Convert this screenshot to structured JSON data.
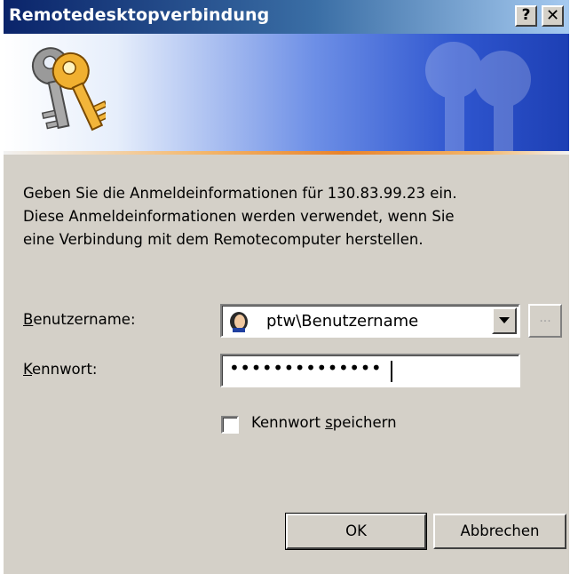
{
  "window": {
    "title": "Remotedesktopverbindung",
    "help_label": "?",
    "close_label": "✕"
  },
  "banner": {
    "icon": "keys-icon",
    "colors": {
      "gradient_start": "#ffffff",
      "gradient_end": "#1d3fb4",
      "accent_line": "#e8832b"
    }
  },
  "message": {
    "line1": "Geben Sie die Anmeldeinformationen für 130.83.99.23 ein.",
    "line2": "Diese Anmeldeinformationen werden verwendet, wenn Sie",
    "line3": "eine Verbindung mit dem Remotecomputer herstellen."
  },
  "form": {
    "username_label_accel": "B",
    "username_label_rest": "enutzername:",
    "username_value": "ptw\\Benutzername",
    "username_icon": "user-icon",
    "browse_label": "...",
    "password_label_accel": "K",
    "password_label_rest": "ennwort:",
    "password_value": "••••••••••••••",
    "save_password_pre": "Kennwort ",
    "save_password_accel": "s",
    "save_password_post": "peichern",
    "save_password_checked": false
  },
  "buttons": {
    "ok": "OK",
    "cancel": "Abbrechen"
  }
}
